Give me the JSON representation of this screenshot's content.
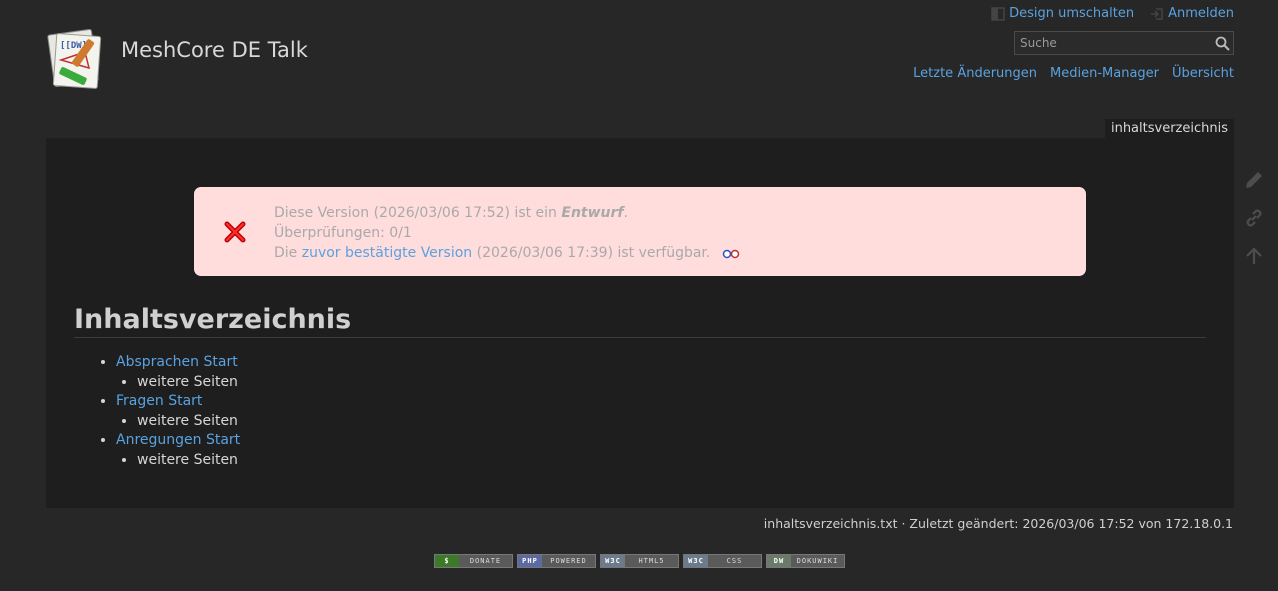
{
  "site": {
    "title": "MeshCore DE Talk"
  },
  "user_tools": [
    {
      "label": "Design umschalten",
      "icon": "design-switch-icon"
    },
    {
      "label": "Anmelden",
      "icon": "login-icon"
    }
  ],
  "search": {
    "placeholder": "Suche"
  },
  "site_tools": [
    {
      "label": "Letzte Änderungen"
    },
    {
      "label": "Medien-Manager"
    },
    {
      "label": "Übersicht"
    }
  ],
  "page_id": "inhaltsverzeichnis",
  "notice": {
    "line1_prefix": "Diese Version (2026/03/06 17:52) ist ein ",
    "line1_status": "Entwurf",
    "line1_suffix": ".",
    "line2": "Überprüfungen: 0/1",
    "line3_prefix": "Die ",
    "line3_link": "zuvor bestätigte Version",
    "line3_suffix": " (2026/03/06 17:39) ist verfügbar."
  },
  "heading": "Inhaltsverzeichnis",
  "toc": [
    {
      "label": "Absprachen Start",
      "sub": "weitere Seiten"
    },
    {
      "label": "Fragen Start",
      "sub": "weitere Seiten"
    },
    {
      "label": "Anregungen Start",
      "sub": "weitere Seiten"
    }
  ],
  "page_tools": [
    "edit-icon",
    "backlinks-icon",
    "back-to-top-icon"
  ],
  "docinfo": "inhaltsverzeichnis.txt · Zuletzt geändert: 2026/03/06 17:52 von 172.18.0.1",
  "badges": [
    {
      "tag": "$",
      "text": "DONATE",
      "color": "#3c7a2a"
    },
    {
      "tag": "PHP",
      "text": "POWERED",
      "color": "#5b6aa0"
    },
    {
      "tag": "W3C",
      "text": "HTML5",
      "color": "#6b7b8c"
    },
    {
      "tag": "W3C",
      "text": "CSS",
      "color": "#6b7b8c"
    },
    {
      "tag": "DW",
      "text": "DOKUWIKI",
      "color": "#6b7b6b"
    }
  ]
}
